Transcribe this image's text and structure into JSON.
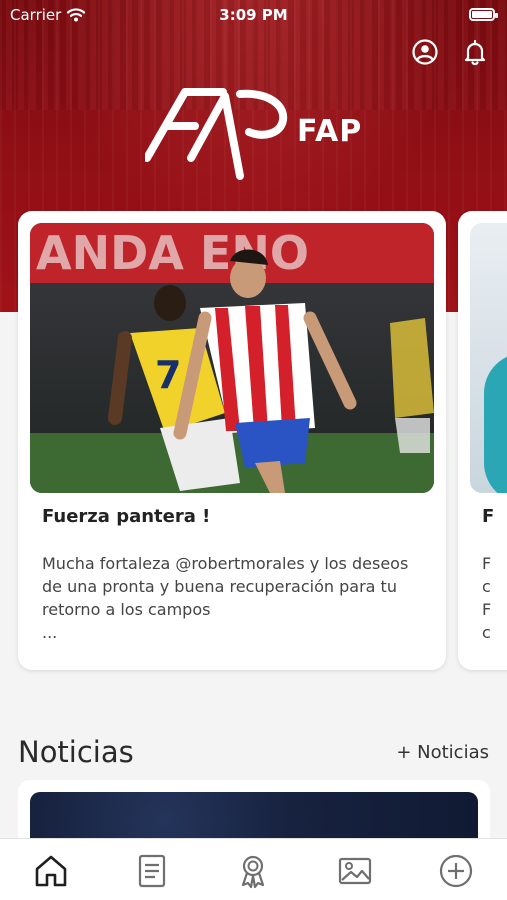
{
  "status_bar": {
    "carrier": "Carrier",
    "time": "3:09 PM"
  },
  "header": {
    "brand": "FAP",
    "icons": [
      "user-circle-icon",
      "bell-icon"
    ]
  },
  "carousel": {
    "cards": [
      {
        "title": "Fuerza pantera !",
        "excerpt": "Mucha fortaleza @robertmorales y los deseos de una pronta y buena recuperación para tu retorno a los campos",
        "ellipsis": "..."
      },
      {
        "title": "F",
        "excerpt_lines": [
          "F",
          "c",
          "F",
          "c"
        ]
      }
    ]
  },
  "news": {
    "title": "Noticias",
    "more_link": "+ Noticias"
  },
  "tabbar": {
    "items": [
      "home-icon",
      "document-icon",
      "award-icon",
      "gallery-icon",
      "add-circle-icon"
    ]
  },
  "colors": {
    "brand_red": "#8e0f15",
    "background": "#f4f4f4"
  }
}
